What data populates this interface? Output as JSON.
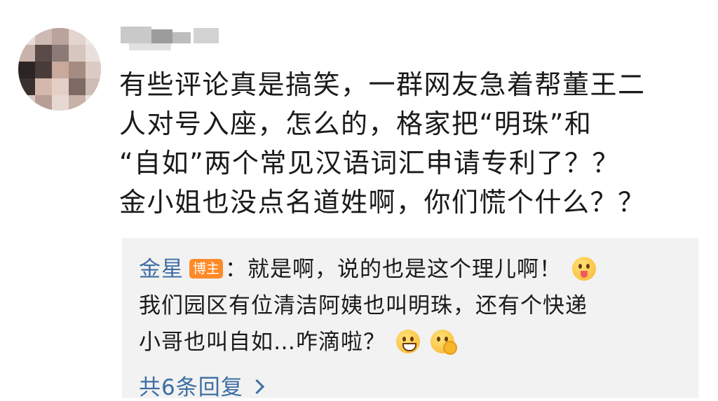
{
  "comment": {
    "lines": [
      "有些评论真是搞笑，一群网友急着帮董王二",
      "人对号入座，怎么的，格家把“明珠”和",
      "“自如”两个常见汉语词汇申请专利了？？",
      "金小姐也没点名道姓啊，你们慌个什么？？"
    ]
  },
  "reply": {
    "author": "金星",
    "badge": "博主",
    "separator": "：",
    "line1_text": "就是啊，说的也是这个理儿啊！",
    "line2_text": "我们园区有位清洁阿姨也叫明珠，还有个快递",
    "line3_text": "小哥也叫自如…咋滴啦？",
    "emojis": [
      "tongue-out-emoji",
      "grin-emoji",
      "hand-over-mouth-emoji"
    ]
  },
  "more_replies": {
    "label": "共6条回复"
  },
  "colors": {
    "link": "#3e6ea3",
    "badge": "#ff8a28",
    "reply_bg": "#f2f2f2",
    "text": "#1a1a1a"
  }
}
